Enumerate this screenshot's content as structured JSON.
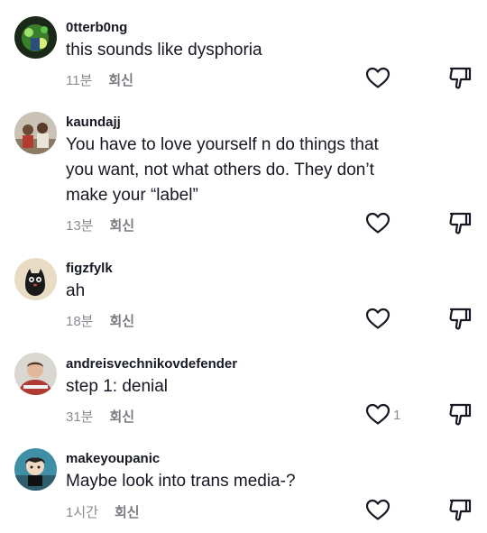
{
  "comments": [
    {
      "username": "0tterb0ng",
      "text": "this sounds like dysphoria",
      "time": "11분",
      "reply": "회신",
      "likes": "",
      "avatar": "green-lights-avatar"
    },
    {
      "username": "kaundajj",
      "text": "You have to love yourself n do things that\nyou want, not what others do. They don’t\nmake your “label”",
      "time": "13분",
      "reply": "회신",
      "likes": "",
      "avatar": "group-photo-avatar"
    },
    {
      "username": "figzfylk",
      "text": "ah",
      "time": "18분",
      "reply": "회신",
      "likes": "",
      "avatar": "black-cat-avatar"
    },
    {
      "username": "andreisvechnikovdefender",
      "text": "step 1: denial",
      "time": "31분",
      "reply": "회신",
      "likes": "1",
      "avatar": "hockey-player-avatar"
    },
    {
      "username": "makeyoupanic",
      "text": "Maybe look into trans media-?",
      "time": "1시간",
      "reply": "회신",
      "likes": "",
      "avatar": "character-avatar"
    }
  ],
  "icons": {
    "like": "heart-outline-icon",
    "dislike": "thumbs-down-icon"
  },
  "colors": {
    "text": "#161823",
    "meta": "#8a8b91"
  }
}
